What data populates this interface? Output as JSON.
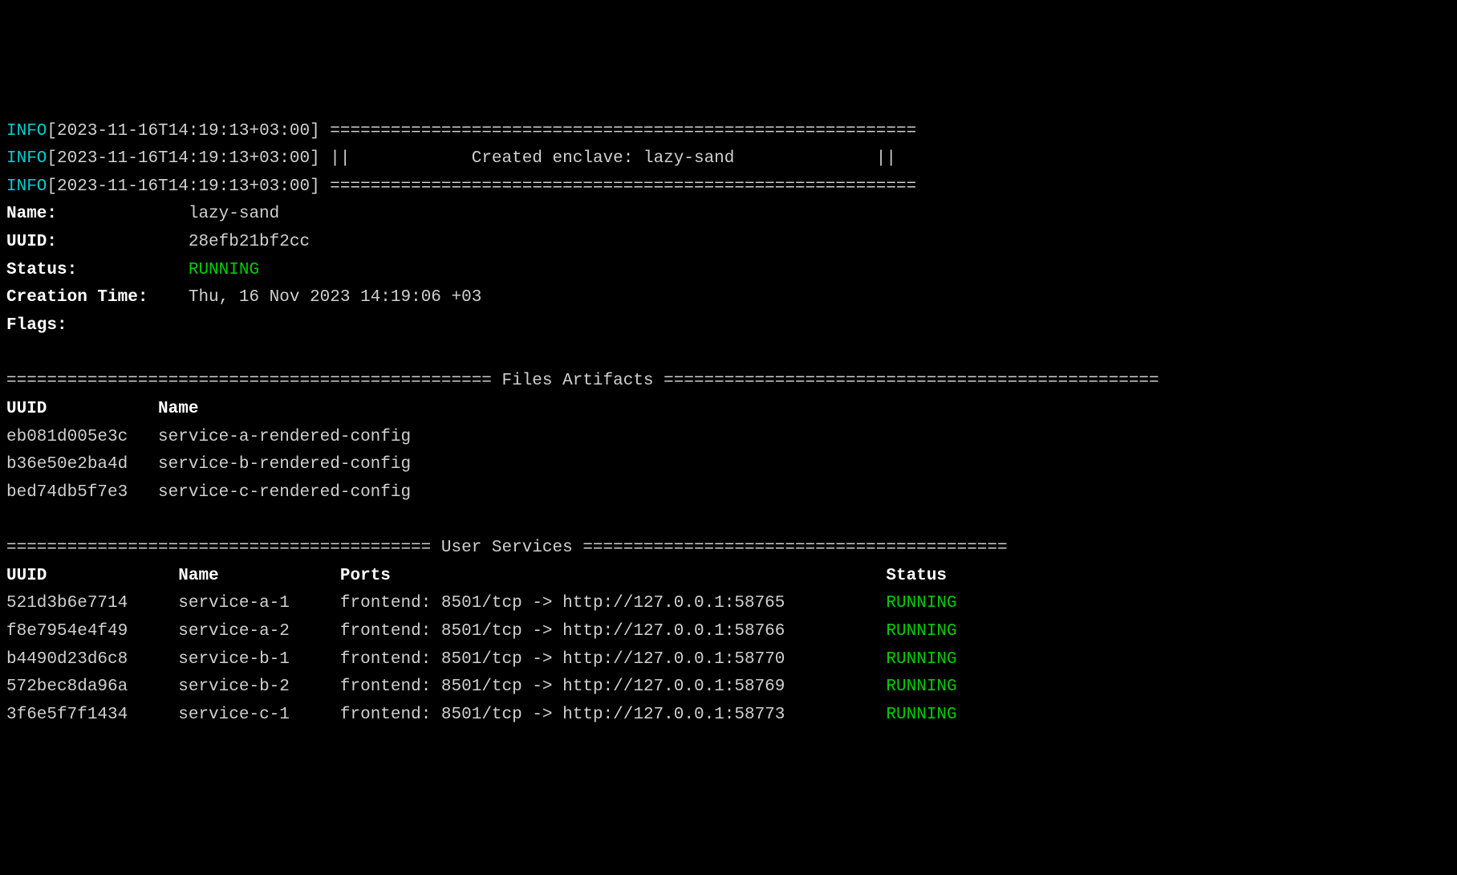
{
  "log": {
    "level": "INFO",
    "timestamp": "[2023-11-16T14:19:13+03:00]",
    "border": "==========================================================",
    "banner_mid": "||            Created enclave: lazy-sand              ||"
  },
  "summary": {
    "labels": {
      "name": "Name:",
      "uuid": "UUID:",
      "status": "Status:",
      "creation": "Creation Time:",
      "flags": "Flags:"
    },
    "values": {
      "name": "lazy-sand",
      "uuid": "28efb21bf2cc",
      "status": "RUNNING",
      "creation": "Thu, 16 Nov 2023 14:19:06 +03",
      "flags": ""
    }
  },
  "files_section": {
    "title_line": "================================================ Files Artifacts =================================================",
    "headers": {
      "uuid": "UUID",
      "name": "Name"
    },
    "rows": [
      {
        "uuid": "eb081d005e3c",
        "name": "service-a-rendered-config"
      },
      {
        "uuid": "b36e50e2ba4d",
        "name": "service-b-rendered-config"
      },
      {
        "uuid": "bed74db5f7e3",
        "name": "service-c-rendered-config"
      }
    ]
  },
  "services_section": {
    "title_line": "========================================== User Services ==========================================",
    "headers": {
      "uuid": "UUID",
      "name": "Name",
      "ports": "Ports",
      "status": "Status"
    },
    "rows": [
      {
        "uuid": "521d3b6e7714",
        "name": "service-a-1",
        "ports": "frontend: 8501/tcp -> http://127.0.0.1:58765",
        "status": "RUNNING"
      },
      {
        "uuid": "f8e7954e4f49",
        "name": "service-a-2",
        "ports": "frontend: 8501/tcp -> http://127.0.0.1:58766",
        "status": "RUNNING"
      },
      {
        "uuid": "b4490d23d6c8",
        "name": "service-b-1",
        "ports": "frontend: 8501/tcp -> http://127.0.0.1:58770",
        "status": "RUNNING"
      },
      {
        "uuid": "572bec8da96a",
        "name": "service-b-2",
        "ports": "frontend: 8501/tcp -> http://127.0.0.1:58769",
        "status": "RUNNING"
      },
      {
        "uuid": "3f6e5f7f1434",
        "name": "service-c-1",
        "ports": "frontend: 8501/tcp -> http://127.0.0.1:58773",
        "status": "RUNNING"
      }
    ]
  }
}
